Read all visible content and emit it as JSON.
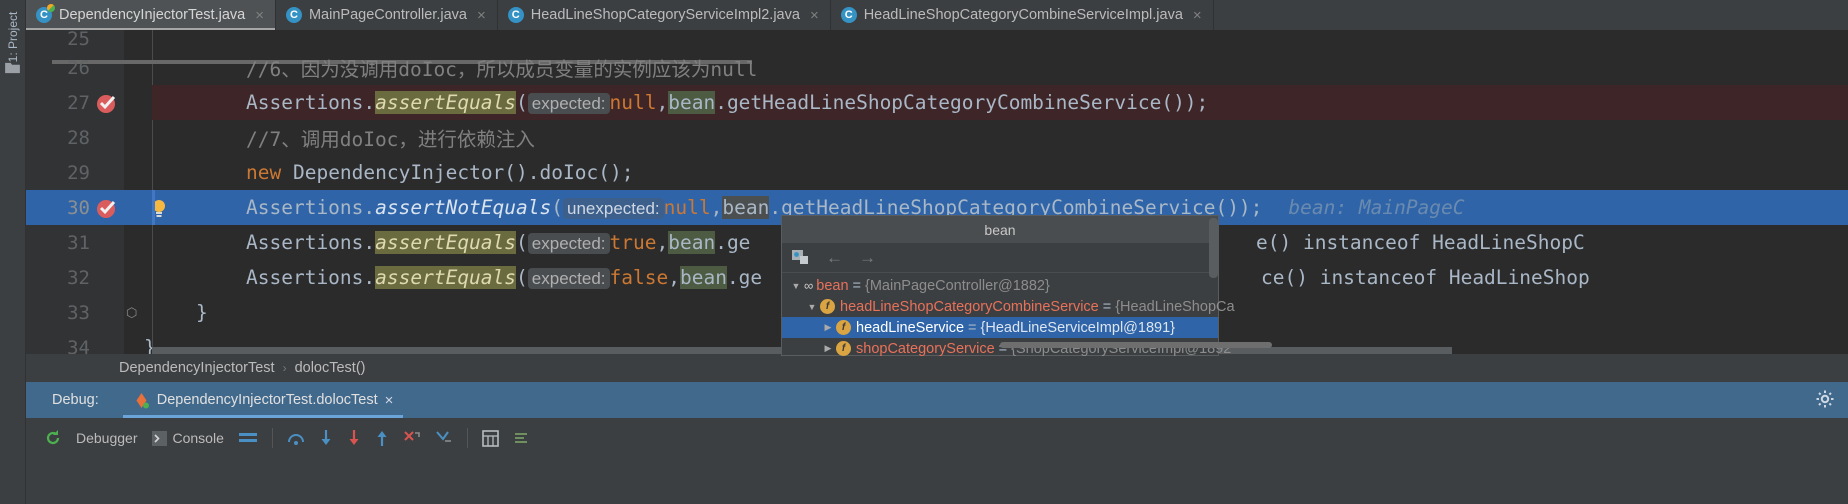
{
  "window": {
    "left_strip_label": "1: Project"
  },
  "tabs": [
    {
      "label": "DependencyInjectorTest.java",
      "icon": "java-test-class-icon",
      "active": true,
      "close": "×"
    },
    {
      "label": "MainPageController.java",
      "icon": "java-class-icon",
      "active": false,
      "close": "×"
    },
    {
      "label": "HeadLineShopCategoryServiceImpl2.java",
      "icon": "java-class-icon",
      "active": false,
      "close": "×"
    },
    {
      "label": "HeadLineShopCategoryCombineServiceImpl.java",
      "icon": "java-class-icon",
      "active": false,
      "close": "×"
    }
  ],
  "editor": {
    "class_letter": "C",
    "lines": [
      {
        "num": "25",
        "partial": true
      },
      {
        "num": "26",
        "comment": "//6、因为没调用doIoc，所以成员变量的实例应该为null"
      },
      {
        "num": "27",
        "prefix": "Assertions.",
        "method": "assertEquals",
        "paren": "(",
        "hint": "expected:",
        "value": "null",
        "comma": ",",
        "bean": "bean",
        "rest": ".getHeadLineShopCategoryCombineService());"
      },
      {
        "num": "28",
        "comment": "//7、调用doIoc，进行依赖注入"
      },
      {
        "num": "29",
        "keyword": "new",
        "text": " DependencyInjector().doIoc();"
      },
      {
        "num": "30",
        "prefix": "Assertions.",
        "method": "assertNotEquals",
        "paren": "(",
        "hint": "unexpected:",
        "value": "null",
        "comma": ",",
        "bean": "bean",
        "rest": ".getHeadLineShopCategoryCombineService());",
        "inline_hint": "bean: MainPageC"
      },
      {
        "num": "31",
        "prefix": "Assertions.",
        "method": "assertEquals",
        "paren": "(",
        "hint": "expected:",
        "value": "true",
        "comma": ",",
        "bean": "bean",
        "rest": ".ge",
        "tail": "e() instanceof HeadLineShopC"
      },
      {
        "num": "32",
        "prefix": "Assertions.",
        "method": "assertEquals",
        "paren": "(",
        "hint": "expected:",
        "value": "false",
        "comma": ",",
        "bean": "bean",
        "rest": ".ge",
        "tail": "ce() instanceof HeadLineShop"
      },
      {
        "num": "33",
        "text": "}"
      },
      {
        "num": "34",
        "text": "}"
      }
    ]
  },
  "breadcrumb": {
    "class": "DependencyInjectorTest",
    "separator": "›",
    "method": "dolocTest()"
  },
  "debug_popup": {
    "title": "bean",
    "toolbar": {
      "watch_icon": "evaluate-expression-icon",
      "back": "←",
      "forward": "→"
    },
    "tree": [
      {
        "depth": 0,
        "twisty": "▼",
        "icon": "object-icon",
        "icon_glyph": "∞",
        "name": "bean",
        "eq": "=",
        "value": "{MainPageController@1882}",
        "selected": false
      },
      {
        "depth": 1,
        "twisty": "▼",
        "icon": "field-icon",
        "icon_glyph": "f",
        "name": "headLineShopCategoryCombineService",
        "eq": "=",
        "value": "{HeadLineShopCa",
        "selected": false
      },
      {
        "depth": 2,
        "twisty": "▶",
        "icon": "field-icon",
        "icon_glyph": "f",
        "name": "headLineService",
        "eq": "=",
        "value": "{HeadLineServiceImpl@1891}",
        "selected": true
      },
      {
        "depth": 2,
        "twisty": "▶",
        "icon": "field-icon",
        "icon_glyph": "f",
        "name": "shopCategoryService",
        "eq": "=",
        "value": "{ShopCategoryServiceImpl@1892",
        "selected": false
      }
    ]
  },
  "debug_window": {
    "label": "Debug:",
    "session_icon": "run-config-icon",
    "session_name": "DependencyInjectorTest.dolocTest",
    "session_close": "×",
    "settings_icon": "gear-icon",
    "toolbar": {
      "rerun_icon": "rerun-icon",
      "debugger_tab": "Debugger",
      "console_icon": "console-icon",
      "console_tab": "Console",
      "layout_icon": "layout-icon",
      "step_over_icon": "step-over-icon",
      "step_into_icon": "step-into-icon",
      "force_step_into_icon": "force-step-into-icon",
      "step_out_icon": "step-out-icon",
      "drop_frame_icon": "drop-frame-icon",
      "run_to_cursor_icon": "run-to-cursor-icon",
      "evaluate_icon": "evaluate-icon",
      "mute_icon": "mute-breakpoints-icon"
    }
  },
  "colors": {
    "accent_blue": "#2f65a8",
    "tab_bg": "#3c3f41",
    "editor_bg": "#2b2b2b",
    "keyword": "#cc7832",
    "comment": "#808080",
    "text": "#a9b7c6",
    "error_line": "#3e2628",
    "debug_header": "#41698c"
  }
}
